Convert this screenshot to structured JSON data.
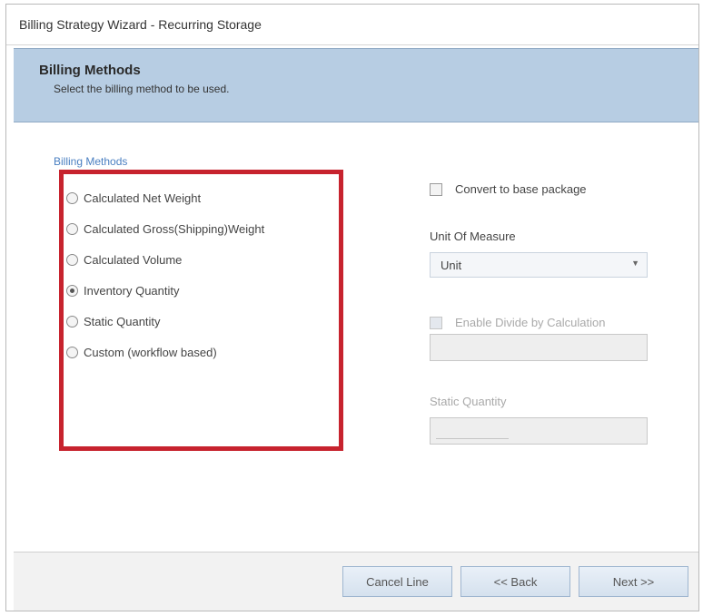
{
  "window": {
    "title": "Billing Strategy Wizard - Recurring Storage"
  },
  "header": {
    "title": "Billing Methods",
    "subtitle": "Select the billing method to be used."
  },
  "billing_methods": {
    "group_label": "Billing Methods",
    "options": [
      {
        "label": "Calculated Net Weight",
        "selected": false
      },
      {
        "label": "Calculated Gross(Shipping)Weight",
        "selected": false
      },
      {
        "label": "Calculated Volume",
        "selected": false
      },
      {
        "label": "Inventory Quantity",
        "selected": true
      },
      {
        "label": "Static Quantity",
        "selected": false
      },
      {
        "label": "Custom (workflow based)",
        "selected": false
      }
    ],
    "highlight_color": "#c7232e"
  },
  "options_panel": {
    "convert_label": "Convert to base package",
    "convert_checked": false,
    "uom_label": "Unit Of Measure",
    "uom_value": "Unit",
    "enable_divide_label": "Enable Divide by Calculation",
    "enable_divide_checked": false,
    "enable_divide_enabled": false,
    "divide_value": "",
    "static_quantity_label": "Static Quantity",
    "static_quantity_value": ""
  },
  "footer": {
    "cancel_label": "Cancel Line",
    "back_label": "<< Back",
    "next_label": "Next >>"
  },
  "colors": {
    "header_band": "#b7cde3",
    "group_label": "#4a7fc1"
  }
}
